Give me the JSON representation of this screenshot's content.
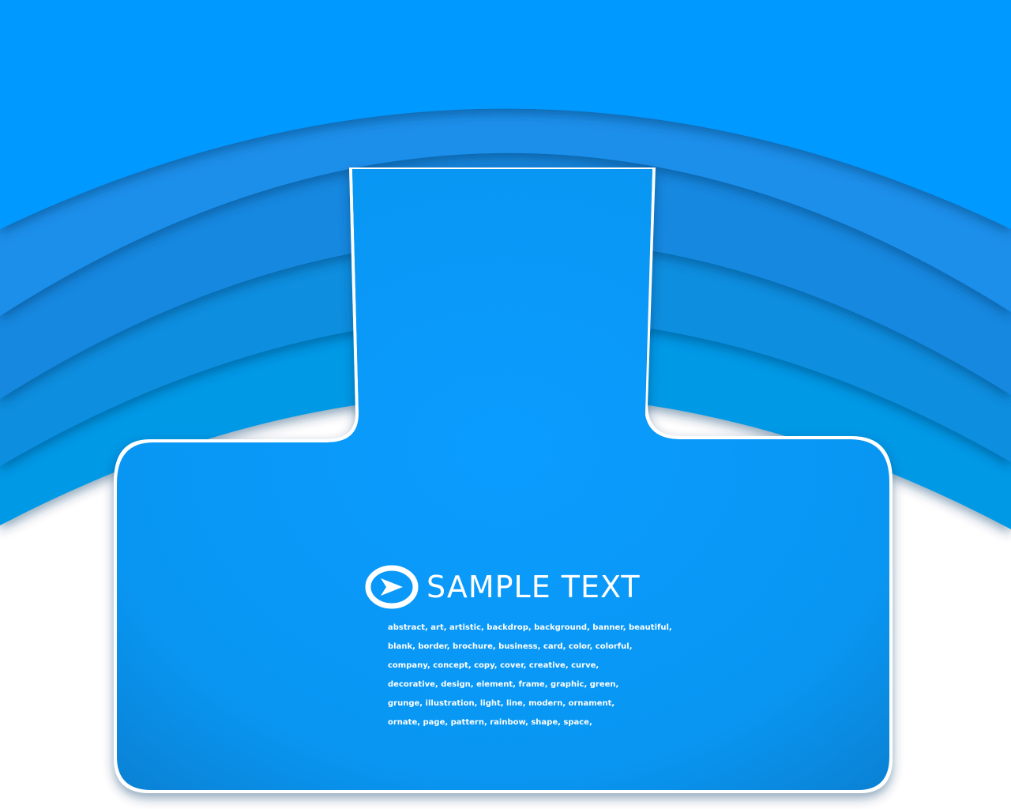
{
  "colors": {
    "band_top": "#0099ff",
    "band_2": "#1a8ee8",
    "band_3": "#1188e2",
    "band_4": "#0a90dc",
    "band_5": "#0399e6",
    "panel": "#0b9cfa",
    "panel_dark": "#0a7fd0",
    "outline": "#ffffff",
    "background": "#ffffff"
  },
  "icons": {
    "logo": "arrow-in-ellipse-icon"
  },
  "headline": "SAMPLE TEXT",
  "keyword_lines": [
    "abstract, art, artistic, backdrop, background, banner, beautiful,",
    "blank, border, brochure, business, card, color, colorful,",
    "company, concept, copy, cover, creative, curve,",
    "decorative, design, element, frame, graphic, green,",
    "grunge, illustration, light, line, modern, ornament,",
    "ornate, page, pattern, rainbow, shape, space,"
  ]
}
